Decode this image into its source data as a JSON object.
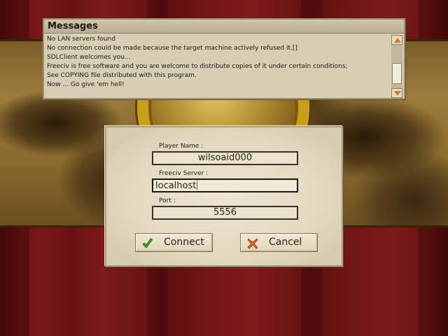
{
  "messages_window": {
    "title": "Messages",
    "lines": [
      "No LAN servers found",
      "No connection could be made because the target machine actively refused it.[]",
      "SDLClient welcomes you...",
      "Freeciv is free software and you are welcome to distribute copies of it under certain conditions;",
      "See COPYING file distributed with this program.",
      "Now ... Go give 'em hell!"
    ]
  },
  "connect_dialog": {
    "player_name_label": "Player Name :",
    "player_name_value": "wilsoaid000",
    "server_label": "Freeciv Server :",
    "server_value": "localhost",
    "port_label": "Port :",
    "port_value": "5556",
    "connect_label": "Connect",
    "cancel_label": "Cancel"
  },
  "icons": {
    "connect": "checkmark-icon",
    "cancel": "cross-icon",
    "scroll_up": "arrow-up-icon",
    "scroll_down": "arrow-down-icon"
  },
  "colors": {
    "background_red": "#7a1818",
    "map_sepia": "#9c7c3c",
    "globe_gold": "#c8a018",
    "dialog_parchment": "#e4d9c0",
    "scroll_arrow": "#e07818",
    "check_green": "#3aa020",
    "cross_orange": "#e06818"
  }
}
